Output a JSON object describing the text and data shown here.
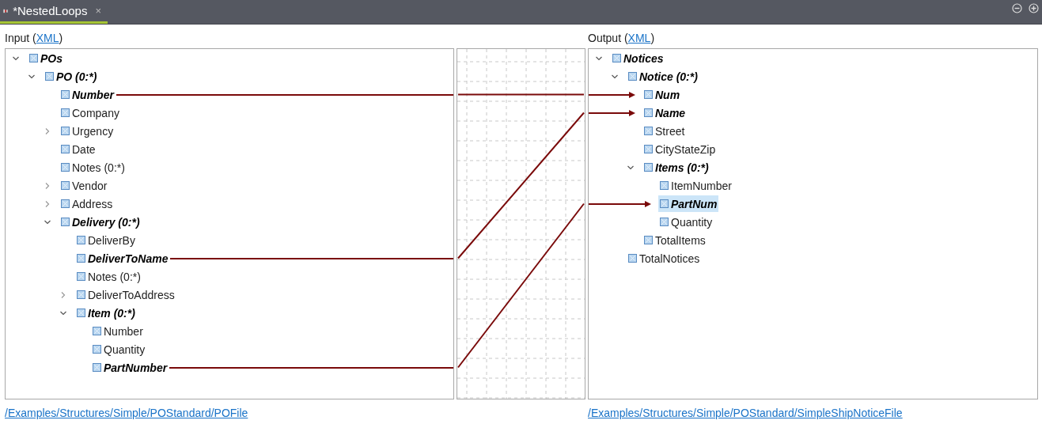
{
  "tab": {
    "title": "*NestedLoops",
    "close": "×",
    "selected": true
  },
  "input": {
    "label": "Input (",
    "format": "XML",
    "label_end": ")",
    "path": "/Examples/Structures/Simple/POStandard/POFile",
    "tree": [
      {
        "label": "POs",
        "mapped": true,
        "selected": false,
        "expanded": true,
        "children": [
          {
            "label": "PO (0:*)",
            "mapped": true,
            "selected": false,
            "expanded": true,
            "children": [
              {
                "label": "Number",
                "mapped": true,
                "selected": false
              },
              {
                "label": "Company",
                "mapped": false,
                "selected": false
              },
              {
                "label": "Urgency",
                "mapped": false,
                "selected": false,
                "expanded": false
              },
              {
                "label": "Date",
                "mapped": false,
                "selected": false
              },
              {
                "label": "Notes (0:*)",
                "mapped": false,
                "selected": false
              },
              {
                "label": "Vendor",
                "mapped": false,
                "selected": false,
                "expanded": false
              },
              {
                "label": "Address",
                "mapped": false,
                "selected": false,
                "expanded": false
              },
              {
                "label": "Delivery (0:*)",
                "mapped": true,
                "selected": false,
                "expanded": true,
                "children": [
                  {
                    "label": "DeliverBy",
                    "mapped": false,
                    "selected": false
                  },
                  {
                    "label": "DeliverToName",
                    "mapped": true,
                    "selected": false
                  },
                  {
                    "label": "Notes (0:*)",
                    "mapped": false,
                    "selected": false
                  },
                  {
                    "label": "DeliverToAddress",
                    "mapped": false,
                    "selected": false,
                    "expanded": false
                  },
                  {
                    "label": "Item (0:*)",
                    "mapped": true,
                    "selected": false,
                    "expanded": true,
                    "children": [
                      {
                        "label": "Number",
                        "mapped": false,
                        "selected": false
                      },
                      {
                        "label": "Quantity",
                        "mapped": false,
                        "selected": false
                      },
                      {
                        "label": "PartNumber",
                        "mapped": true,
                        "selected": false
                      }
                    ]
                  }
                ]
              }
            ]
          }
        ]
      }
    ]
  },
  "output": {
    "label": "Output (",
    "format": "XML",
    "label_end": ")",
    "path": "/Examples/Structures/Simple/POStandard/SimpleShipNoticeFile",
    "tree": [
      {
        "label": "Notices",
        "mapped": true,
        "selected": false,
        "expanded": true,
        "children": [
          {
            "label": "Notice (0:*)",
            "mapped": true,
            "selected": false,
            "expanded": true,
            "children": [
              {
                "label": "Num",
                "mapped": true,
                "selected": false
              },
              {
                "label": "Name",
                "mapped": true,
                "selected": false
              },
              {
                "label": "Street",
                "mapped": false,
                "selected": false
              },
              {
                "label": "CityStateZip",
                "mapped": false,
                "selected": false
              },
              {
                "label": "Items (0:*)",
                "mapped": true,
                "selected": false,
                "expanded": true,
                "children": [
                  {
                    "label": "ItemNumber",
                    "mapped": false,
                    "selected": false
                  },
                  {
                    "label": "PartNum",
                    "mapped": true,
                    "selected": true
                  },
                  {
                    "label": "Quantity",
                    "mapped": false,
                    "selected": false
                  }
                ]
              },
              {
                "label": "TotalItems",
                "mapped": false,
                "selected": false
              }
            ]
          },
          {
            "label": "TotalNotices",
            "mapped": false,
            "selected": false
          }
        ]
      }
    ]
  }
}
